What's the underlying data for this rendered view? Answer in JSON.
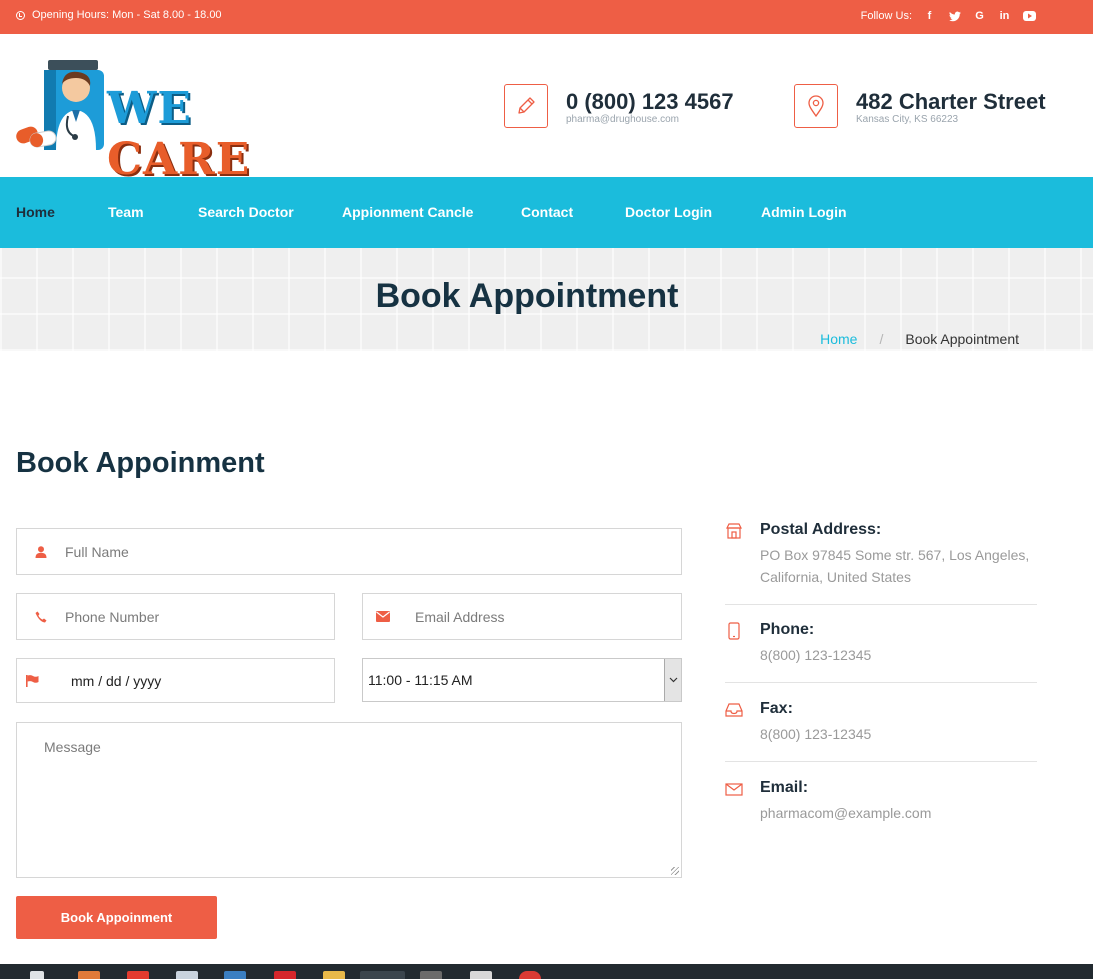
{
  "topbar": {
    "hours": "Opening Hours: Mon - Sat 8.00 - 18.00",
    "follow_label": "Follow Us:",
    "social": [
      "facebook-icon",
      "twitter-icon",
      "google-icon",
      "linkedin-icon",
      "youtube-icon"
    ]
  },
  "logo": {
    "word1": "WE",
    "word2": "CARE"
  },
  "header": {
    "phone": "0 (800) 123 4567",
    "email": "pharma@drughouse.com",
    "address": "482 Charter Street",
    "city": "Kansas City, KS 66223"
  },
  "nav": {
    "items": [
      "Home",
      "Team",
      "Search Doctor",
      "Appionment Cancle",
      "Contact",
      "Doctor Login",
      "Admin Login"
    ],
    "active": "Home"
  },
  "banner": {
    "title": "Book Appointment",
    "breadcrumb_home": "Home",
    "breadcrumb_sep": "/",
    "breadcrumb_current": "Book Appointment"
  },
  "form": {
    "title": "Book Appoinment",
    "full_name_placeholder": "Full Name",
    "phone_placeholder": "Phone Number",
    "email_placeholder": "Email Address",
    "date_value": "mm / dd / yyyy",
    "time_selected": "11:00 - 11:15 AM",
    "message_placeholder": "Message",
    "submit_label": "Book Appoinment"
  },
  "info": {
    "postal_label": "Postal Address:",
    "postal_value": "PO Box 97845 Some str. 567, Los Angeles, California, United States",
    "phone_label": "Phone:",
    "phone_value": "8(800) 123-12345",
    "fax_label": "Fax:",
    "fax_value": "8(800) 123-12345",
    "email_label": "Email:",
    "email_value": "pharmacom@example.com"
  },
  "colors": {
    "accent": "#ee5e45",
    "nav": "#1bbcdc",
    "heading": "#163242"
  }
}
